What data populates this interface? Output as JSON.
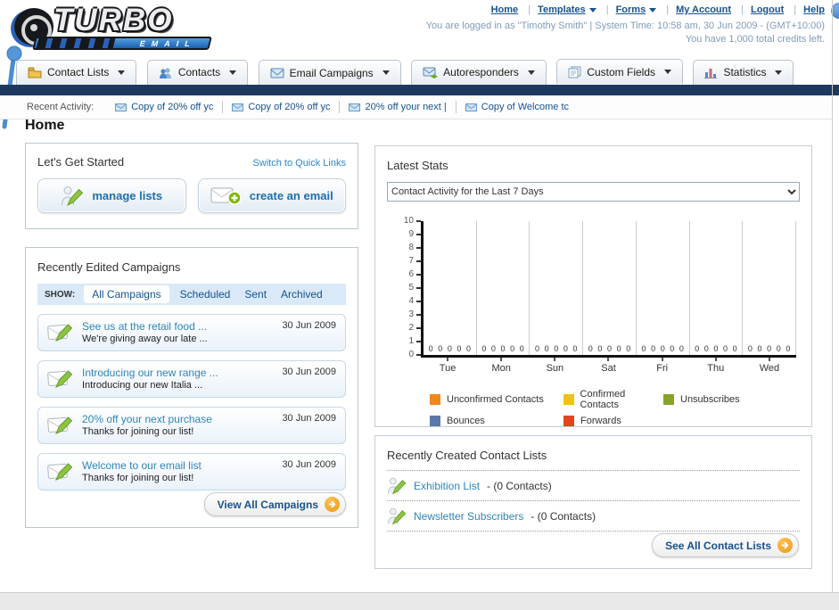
{
  "header": {
    "links": [
      {
        "label": "Home"
      },
      {
        "label": "Templates",
        "has_menu": true
      },
      {
        "label": "Forms",
        "has_menu": true
      },
      {
        "label": "My Account"
      },
      {
        "label": "Logout"
      },
      {
        "label": "Help"
      }
    ],
    "login_line": "You are logged in as \"Timothy Smith\" | System Time: 10:58 am, 30 Jun 2009 - (GMT+10:00)",
    "credits_line": "You have 1,000 total credits left.",
    "logo_title": "TURBO",
    "logo_subtitle": "EMAIL"
  },
  "nav": {
    "items": [
      {
        "label": "Contact Lists",
        "icon": "folder-icon"
      },
      {
        "label": "Contacts",
        "icon": "contacts-icon"
      },
      {
        "label": "Email Campaigns",
        "icon": "envelope-icon"
      },
      {
        "label": "Autoresponders",
        "icon": "envelope-arrow-icon"
      },
      {
        "label": "Custom Fields",
        "icon": "pages-icon"
      },
      {
        "label": "Statistics",
        "icon": "bar-chart-icon"
      }
    ]
  },
  "recent_activity": {
    "label": "Recent Activity:",
    "items": [
      {
        "label": "Copy of 20% off yc"
      },
      {
        "label": "Copy of 20% off yc"
      },
      {
        "label": "20% off your next |"
      },
      {
        "label": "Copy of Welcome tc"
      }
    ]
  },
  "home": {
    "title": "Home"
  },
  "get_started": {
    "title": "Let's Get Started",
    "switch_link": "Switch to Quick Links",
    "manage_lists_label": "manage lists",
    "create_email_label": "create an email"
  },
  "campaigns": {
    "title": "Recently Edited Campaigns",
    "show_label": "SHOW:",
    "tabs": [
      {
        "label": "All Campaigns",
        "active": true
      },
      {
        "label": "Scheduled"
      },
      {
        "label": "Sent"
      },
      {
        "label": "Archived"
      }
    ],
    "items": [
      {
        "title": "See us at the retail food ...",
        "subtitle": "We're giving away our late ...",
        "date": "30 Jun 2009"
      },
      {
        "title": "Introducing our new range ...",
        "subtitle": "Introducing our new Italia ...",
        "date": "30 Jun 2009"
      },
      {
        "title": "20% off your next purchase",
        "subtitle": "Thanks for joining our list!",
        "date": "30 Jun 2009"
      },
      {
        "title": "Welcome to our email list",
        "subtitle": "Thanks for joining our list!",
        "date": "30 Jun 2009"
      }
    ],
    "view_all_label": "View All Campaigns"
  },
  "stats": {
    "title": "Latest Stats",
    "dropdown_value": "Contact Activity for the Last 7 Days"
  },
  "chart_data": {
    "type": "bar",
    "title": "Contact Activity for the Last 7 Days",
    "categories": [
      "Tue",
      "Mon",
      "Sun",
      "Sat",
      "Fri",
      "Thu",
      "Wed"
    ],
    "series": [
      {
        "name": "Unconfirmed Contacts",
        "color": "#F0861E",
        "values": [
          0,
          0,
          0,
          0,
          0,
          0,
          0
        ]
      },
      {
        "name": "Confirmed Contacts",
        "color": "#F2C01A",
        "values": [
          0,
          0,
          0,
          0,
          0,
          0,
          0
        ]
      },
      {
        "name": "Unsubscribes",
        "color": "#87A32B",
        "values": [
          0,
          0,
          0,
          0,
          0,
          0,
          0
        ]
      },
      {
        "name": "Bounces",
        "color": "#5B77A8",
        "values": [
          0,
          0,
          0,
          0,
          0,
          0,
          0
        ]
      },
      {
        "name": "Forwards",
        "color": "#E1461F",
        "values": [
          0,
          0,
          0,
          0,
          0,
          0,
          0
        ]
      }
    ],
    "ylim": [
      0,
      10
    ],
    "yticks": [
      0,
      1,
      2,
      3,
      4,
      5,
      6,
      7,
      8,
      9,
      10
    ],
    "grid": "vertical-group-separators-only",
    "legend_position": "bottom",
    "value_labels_shown": true
  },
  "contact_lists": {
    "title": "Recently Created Contact Lists",
    "items": [
      {
        "name": "Exhibition List",
        "suffix": " - (0 Contacts)"
      },
      {
        "name": "Newsletter Subscribers",
        "suffix": " - (0 Contacts)"
      }
    ],
    "see_all_label": "See All Contact Lists"
  },
  "colors": {
    "link_blue": "#17528f",
    "navy_strip": "#1b3a5e",
    "accent_orange": "#EF9714",
    "panel_border": "#b7c9d6"
  }
}
